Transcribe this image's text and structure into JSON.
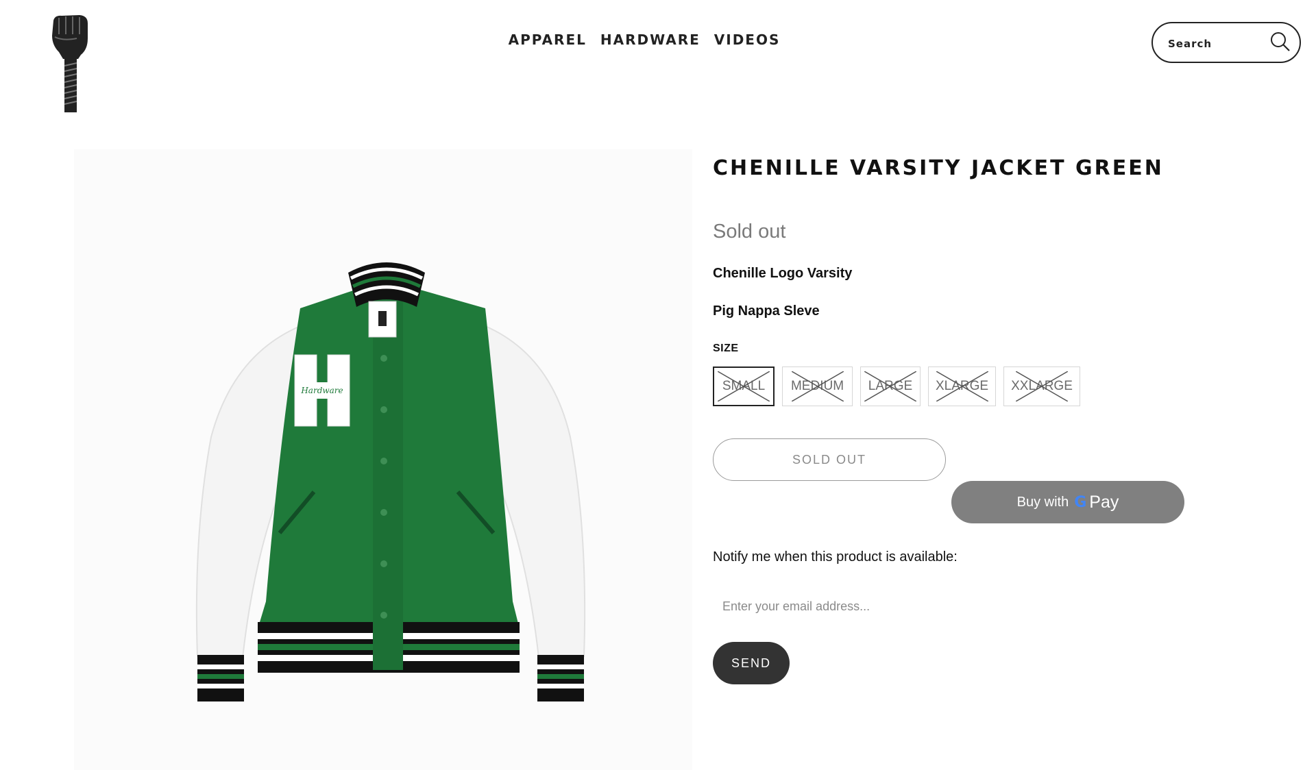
{
  "header": {
    "logo_icon": "raised-fist-bolt-logo",
    "nav": [
      "APPAREL",
      "HARDWARE",
      "VIDEOS"
    ],
    "search_placeholder": "Search",
    "search_icon": "search-icon"
  },
  "product": {
    "image_alt": "green-white-varsity-jacket",
    "title": "CHENILLE VARSITY JACKET GREEN",
    "price_status": "Sold out",
    "description": [
      "Chenille Logo Varsity",
      "Pig Nappa Sleve"
    ],
    "size_label": "SIZE",
    "sizes": [
      "SMALL",
      "MEDIUM",
      "LARGE",
      "XLARGE",
      "XXLARGE"
    ],
    "selected_size": "SMALL",
    "sold_out_button": "SOLD OUT",
    "gpay": {
      "prefix": "Buy with",
      "g": "G",
      "suffix": "Pay"
    },
    "notify_text": "Notify me when this product is available:",
    "email_placeholder": "Enter your email address...",
    "send_button": "SEND"
  },
  "colors": {
    "jacket_green": "#1f7a3a",
    "button_dark": "#333333",
    "gpay_grey": "#808080",
    "sold_out_text": "#7a7a7a"
  }
}
